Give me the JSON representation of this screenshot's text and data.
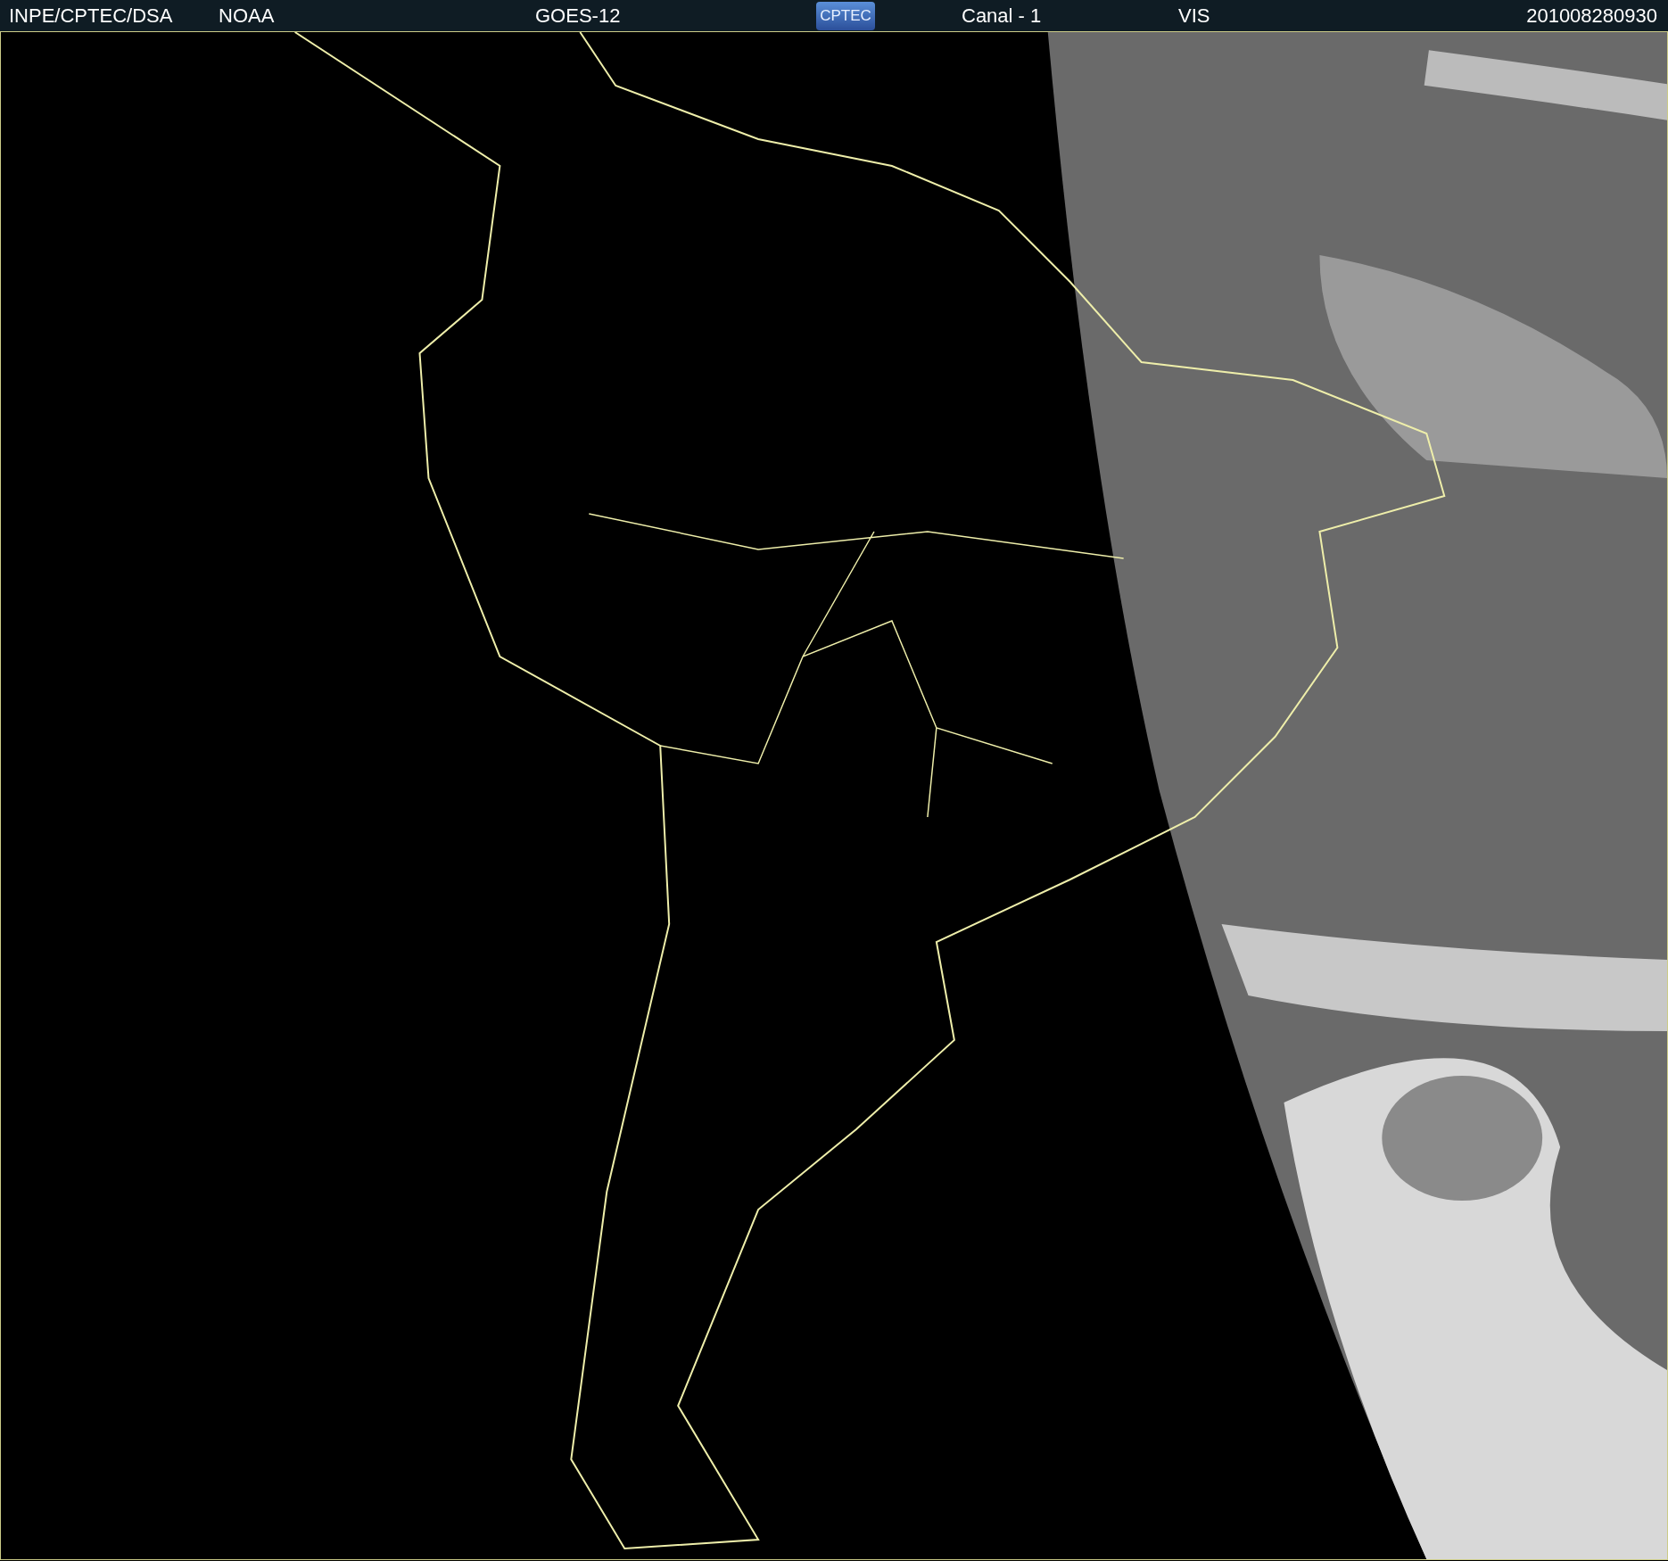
{
  "header": {
    "items": [
      {
        "kind": "text",
        "text": "INPE/CPTEC/DSA"
      },
      {
        "kind": "text",
        "text": "NOAA"
      },
      {
        "kind": "text",
        "text": "GOES-12"
      },
      {
        "kind": "logo",
        "text": "CPTEC"
      },
      {
        "kind": "text",
        "text": "Canal - 1"
      },
      {
        "kind": "text",
        "text": "VIS"
      },
      {
        "kind": "text",
        "text": "201008280930"
      }
    ]
  }
}
